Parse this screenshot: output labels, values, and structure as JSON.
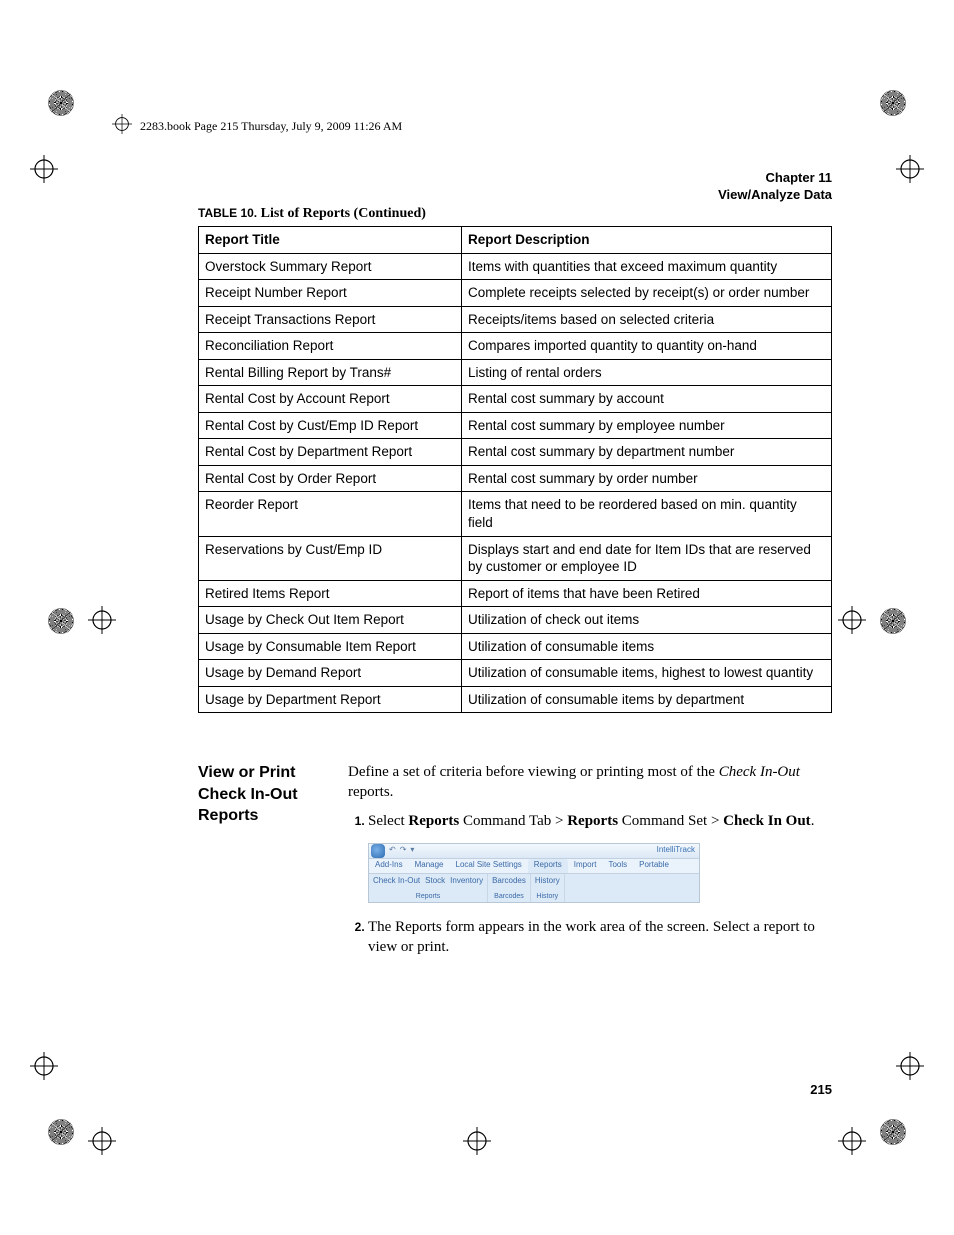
{
  "header_file_info": "2283.book  Page 215  Thursday, July 9, 2009  11:26 AM",
  "chapter_line1": "Chapter 11",
  "chapter_line2": "View/Analyze Data",
  "table_caption_lead": "TABLE 10.",
  "table_caption_rest": " List of Reports (Continued)",
  "table_header_title": "Report Title",
  "table_header_desc": "Report Description",
  "reports": [
    {
      "title": "Overstock Summary Report",
      "desc": "Items with quantities that exceed maximum quantity"
    },
    {
      "title": "Receipt Number Report",
      "desc": "Complete receipts selected by receipt(s) or order number"
    },
    {
      "title": "Receipt Transactions Report",
      "desc": "Receipts/items based on selected criteria"
    },
    {
      "title": "Reconciliation Report",
      "desc": "Compares imported quantity to quantity on-hand"
    },
    {
      "title": "Rental Billing Report by Trans#",
      "desc": "Listing of rental orders"
    },
    {
      "title": "Rental Cost by Account Report",
      "desc": "Rental cost summary by account"
    },
    {
      "title": "Rental Cost by Cust/Emp ID Report",
      "desc": "Rental cost summary by employee number"
    },
    {
      "title": "Rental Cost by Department Report",
      "desc": "Rental cost summary by department number"
    },
    {
      "title": "Rental Cost by Order Report",
      "desc": "Rental cost summary by order number"
    },
    {
      "title": "Reorder Report",
      "desc": "Items that need to be reordered based on min. quantity field"
    },
    {
      "title": "Reservations by Cust/Emp ID",
      "desc": "Displays start and end date for Item IDs that are reserved by customer or employee ID"
    },
    {
      "title": "Retired Items Report",
      "desc": "Report of items that have been Retired"
    },
    {
      "title": "Usage by Check Out Item Report",
      "desc": "Utilization of check out items"
    },
    {
      "title": "Usage by Consumable Item Report",
      "desc": "Utilization of consumable items"
    },
    {
      "title": "Usage by Demand Report",
      "desc": "Utilization of consumable items, highest to lowest quantity"
    },
    {
      "title": "Usage by Department Report",
      "desc": "Utilization of consumable items by department"
    }
  ],
  "section_title": "View or Print Check In-Out Reports",
  "intro_before_italic": "Define a set of criteria before viewing or printing most of the ",
  "intro_italic": "Check In-Out",
  "intro_after_italic": " reports.",
  "step1_prefix": "Select ",
  "step1_b1": "Reports",
  "step1_mid1": " Command Tab > ",
  "step1_b2": "Reports",
  "step1_mid2": " Command Set > ",
  "step1_b3": "Check In Out",
  "step1_suffix": ".",
  "step2": "The Reports form appears in the work area of the screen. Select a report to view or print.",
  "ribbon": {
    "brand": "IntelliTrack",
    "tabs": [
      "Add-Ins",
      "Manage",
      "Local Site Settings",
      "Reports",
      "Import",
      "Tools",
      "Portable"
    ],
    "active_tab_index": 3,
    "group1_btns": [
      "Check In-Out",
      "Stock",
      "Inventory"
    ],
    "group1_label": "Reports",
    "group2a_btn": "Barcodes",
    "group2a_label": "Barcodes",
    "group2b_btn": "History",
    "group2b_label": "History",
    "qat": [
      "↶",
      "↷",
      "▾"
    ]
  },
  "page_number": "215"
}
